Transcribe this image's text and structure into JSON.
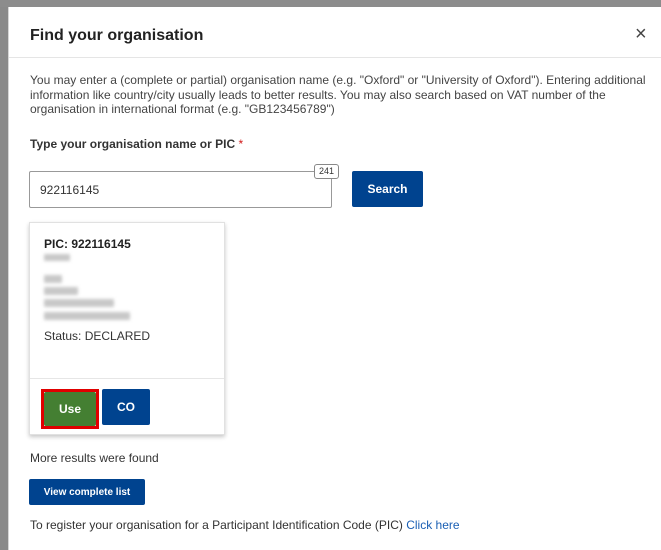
{
  "dialog": {
    "title": "Find your organisation",
    "close_symbol": "×",
    "intro": "You may enter a (complete or partial) organisation name (e.g. \"Oxford\" or \"University of Oxford\"). Entering additional information like country/city usually leads to better results. You may also search based on VAT number of the organisation in international format (e.g. \"GB123456789\")"
  },
  "search": {
    "label": "Type your organisation name or PIC",
    "required_mark": "*",
    "value": "922116145",
    "char_count": "241",
    "button_label": "Search"
  },
  "result_card": {
    "pic_label": "PIC: 922116145",
    "status": "Status: DECLARED",
    "use_label": "Use",
    "co_label": "CO"
  },
  "results": {
    "more_text": "More results were found",
    "view_list_label": "View complete list"
  },
  "footer": {
    "register_text": "To register your organisation for a Participant Identification Code (PIC)",
    "register_link": "Click here"
  },
  "colors": {
    "primary_blue": "#00438f",
    "use_green": "#447f32",
    "highlight_red": "#e00000",
    "link_blue": "#1a5fb4"
  }
}
